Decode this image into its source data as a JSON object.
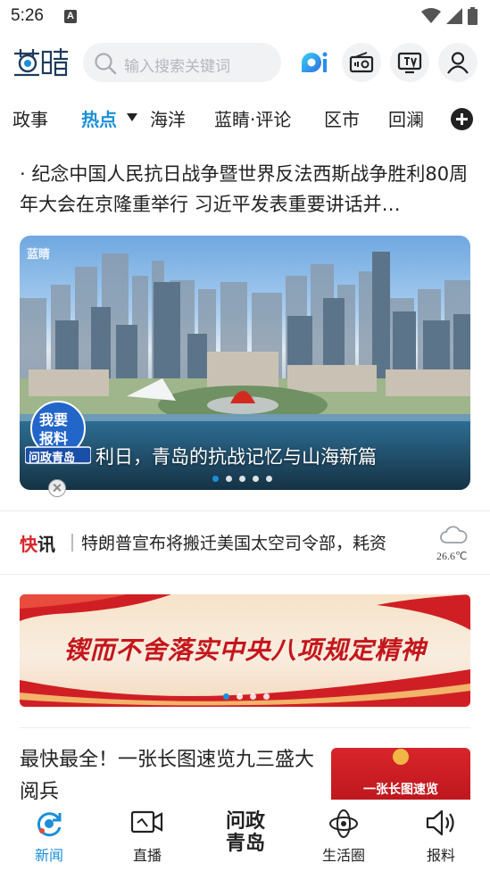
{
  "status_bar": {
    "time": "5:26",
    "notif_letter": "A"
  },
  "header": {
    "logo_text": "蓝睛",
    "search_placeholder": "输入搜索关键词",
    "ai_label": "i"
  },
  "tabs": [
    {
      "label": "政事",
      "active": false
    },
    {
      "label": "热点",
      "active": true
    },
    {
      "label": "海洋",
      "active": false
    },
    {
      "label": "蓝睛·评论",
      "active": false
    },
    {
      "label": "区市",
      "active": false
    },
    {
      "label": "回澜",
      "active": false
    }
  ],
  "headline": {
    "text": "· 纪念中国人民抗日战争暨世界反法西斯战争胜利80周年大会在京隆重举行 习近平发表重要讲话并…"
  },
  "banner": {
    "watermark": "蓝睛",
    "caption": "利日，青岛的抗战记忆与山海新篇",
    "slides": 5,
    "active_slide": 0
  },
  "report_badge": {
    "line1": "我要",
    "line2": "报料",
    "ribbon": "问政青岛"
  },
  "flash": {
    "label_red": "快",
    "label_dark": "讯",
    "text": "特朗普宣布将搬迁美国太空司令部，耗资",
    "temperature": "26.6℃",
    "weather_icon": "cloud-icon"
  },
  "promo": {
    "text": "锲而不舍落实中央八项规定精神",
    "slides": 4,
    "active_slide": 0
  },
  "article": {
    "title": "最快最全！一张长图速览九三盛大阅兵",
    "thumb_text": "一张长图速览"
  },
  "bottom_nav": [
    {
      "label": "新闻",
      "icon": "refresh-icon",
      "active": true
    },
    {
      "label": "直播",
      "icon": "video-camera-icon",
      "active": false
    },
    {
      "label": "问政\n青岛",
      "icon": "",
      "active": false
    },
    {
      "label": "生活圈",
      "icon": "atom-icon",
      "active": false
    },
    {
      "label": "报料",
      "icon": "speaker-icon",
      "active": false
    }
  ],
  "colors": {
    "accent": "#1a8fd8",
    "flash_red": "#d8252a",
    "promo_red": "#c4161c"
  }
}
